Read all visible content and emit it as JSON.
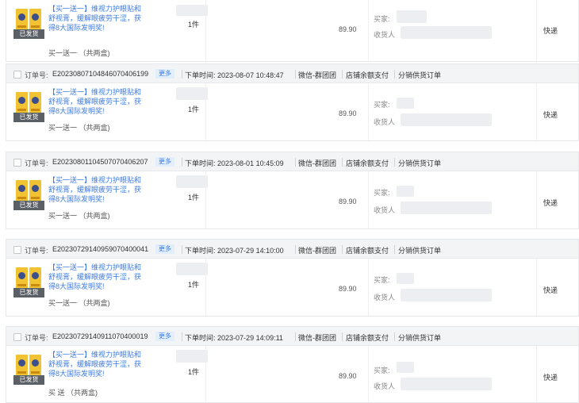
{
  "labels": {
    "order_no": "订单号:",
    "more": "更多",
    "order_time": "下单时间:",
    "badge": "已发货",
    "qty": "1件",
    "buyer": "买家:",
    "receiver": "收货人"
  },
  "first": {
    "title": "【买一送一】维视力护眼贴和舒视膏，缓解眼疲劳干涩，获得8大国际发明奖!",
    "spec": "买一送一 （共两盒)",
    "price": "89.90",
    "shipping": "快递"
  },
  "orders": [
    {
      "order_no": "E20230807104846070406199",
      "order_time": "2023-08-07 10:48:47",
      "channel": "微信-群团团",
      "pay": "店铺余额支付",
      "type": "分销供货订单",
      "title": "【买一送一】维视力护眼贴和舒视膏，缓解眼疲劳干涩，获得8大国际发明奖!",
      "spec": "买一送一 （共两盒)",
      "price": "89.90",
      "shipping": "快递"
    },
    {
      "order_no": "E20230801104507070406207",
      "order_time": "2023-08-01 10:45:09",
      "channel": "微信-群团团",
      "pay": "店铺余额支付",
      "type": "分销供货订单",
      "title": "【买一送一】维视力护眼贴和舒视膏，缓解眼疲劳干涩，获得8大国际发明奖!",
      "spec": "买一送一 （共两盒)",
      "price": "89.90",
      "shipping": "快递"
    },
    {
      "order_no": "E20230729140959070400041",
      "order_time": "2023-07-29 14:10:00",
      "channel": "微信-群团团",
      "pay": "店铺余额支付",
      "type": "分销供货订单",
      "title": "【买一送一】维视力护眼贴和舒视膏，缓解眼疲劳干涩，获得8大国际发明奖!",
      "spec": "买一送一 （共两盒)",
      "price": "89.90",
      "shipping": "快递"
    },
    {
      "order_no": "E20230729140911070400019",
      "order_time": "2023-07-29 14:09:11",
      "channel": "微信-群团团",
      "pay": "店铺余额支付",
      "type": "分销供货订单",
      "title": "【买一送一】维视力护眼贴和舒视膏，缓解眼疲劳干涩，获得8大国际发明奖!",
      "spec": "买 送 （共两盒)",
      "price": "89.90",
      "shipping": "快递"
    }
  ],
  "colors": {
    "link": "#3d7be3",
    "header_bg": "#f3f4f6",
    "badge_bg": "#5b5f66"
  }
}
